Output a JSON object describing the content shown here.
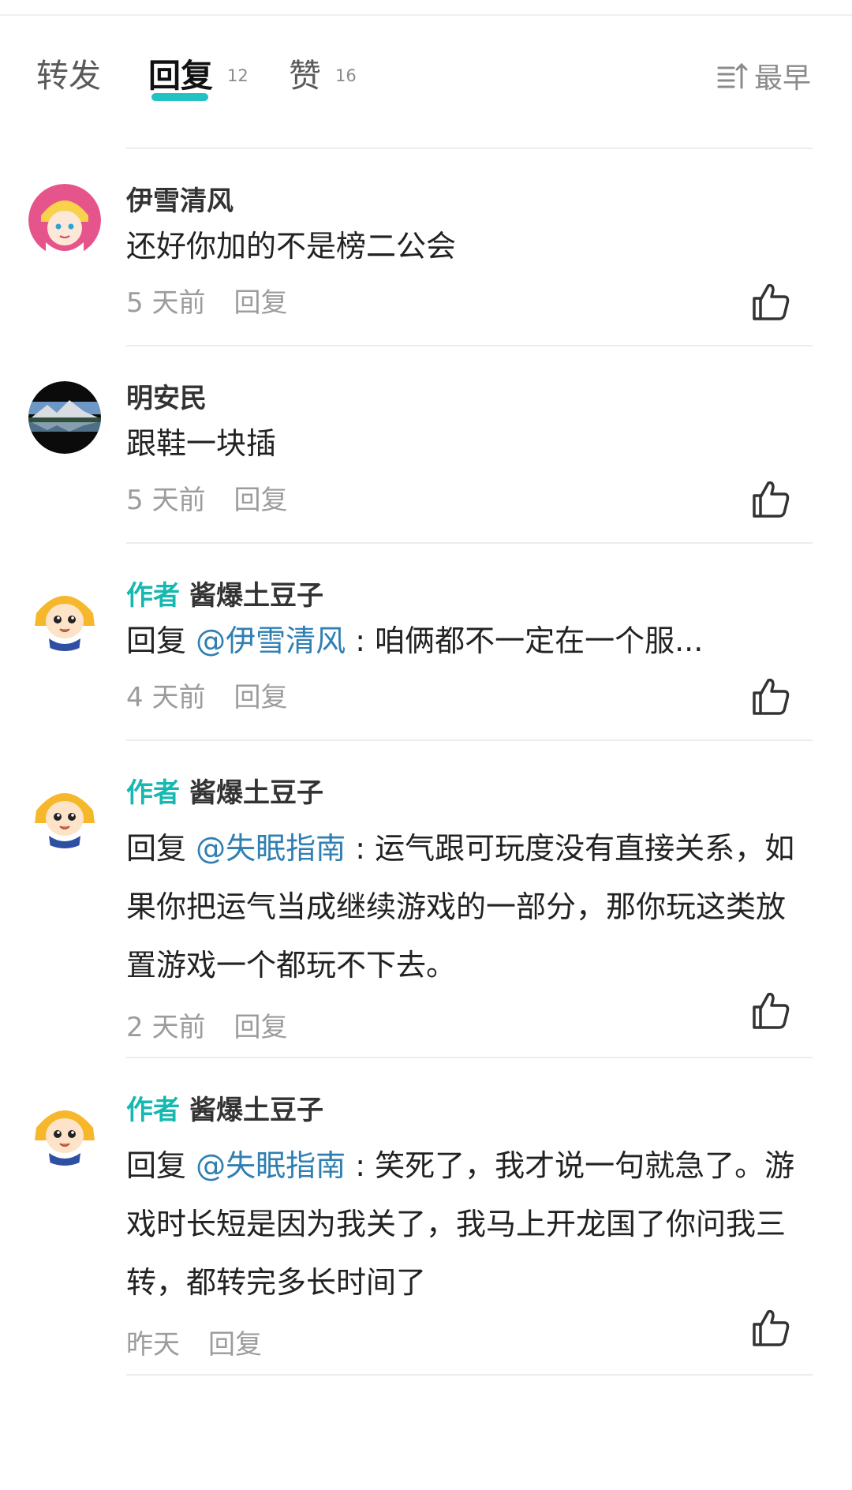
{
  "tabs": {
    "forward": {
      "label": "转发"
    },
    "reply": {
      "label": "回复",
      "count": "12"
    },
    "like": {
      "label": "赞",
      "count": "16"
    },
    "sort": {
      "label": "最早",
      "icon": "sort-icon"
    }
  },
  "colors": {
    "accent": "#22c1c3",
    "author_tag": "#16b8b0",
    "mention": "#2f7fb2",
    "muted": "#9c9c9c"
  },
  "comments": [
    {
      "username": "伊雪清风",
      "text": "还好你加的不是榜二公会",
      "time": "5 天前",
      "reply_label": "回复",
      "avatar": "anime-girl-avatar"
    },
    {
      "username": "明安民",
      "text": "跟鞋一块插",
      "time": "5 天前",
      "reply_label": "回复",
      "avatar": "landscape-avatar"
    },
    {
      "author_tag": "作者",
      "username": "酱爆土豆子",
      "reply_prefix": "回复 ",
      "mention": "@伊雪清风",
      "text": " : 咱俩都不一定在一个服...",
      "time": "4 天前",
      "reply_label": "回复",
      "avatar": "cartoon-girl-avatar"
    },
    {
      "author_tag": "作者",
      "username": "酱爆土豆子",
      "reply_prefix": "回复 ",
      "mention": "@失眠指南",
      "text": " : 运气跟可玩度没有直接关系，如果你把运气当成继续游戏的一部分，那你玩这类放置游戏一个都玩不下去。",
      "time": "2 天前",
      "reply_label": "回复",
      "avatar": "cartoon-girl-avatar"
    },
    {
      "author_tag": "作者",
      "username": "酱爆土豆子",
      "reply_prefix": "回复 ",
      "mention": "@失眠指南",
      "text": " : 笑死了，我才说一句就急了。游戏时长短是因为我关了，我马上开龙国了你问我三转，都转完多长时间了",
      "time": "昨天",
      "reply_label": "回复",
      "avatar": "cartoon-girl-avatar"
    }
  ]
}
